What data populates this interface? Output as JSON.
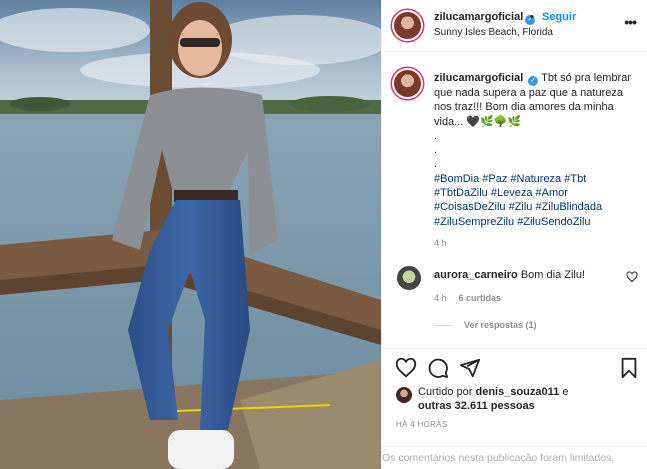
{
  "post": {
    "username": "zilucamargoficial",
    "verified_glyph": "✓",
    "dot": "•",
    "follow_label": "Seguir",
    "location": "Sunny Isles Beach, Florida",
    "more_icon": "more-icon"
  },
  "caption": {
    "username": "zilucamargoficial",
    "text": "Tbt só pra lembrar que nada supera a paz que a natureza nos traz!!! Bom dia amores da minha vida... 🖤🌿🌳🌿",
    "dots": [
      ".",
      ".",
      "."
    ],
    "hashtags": "#BomDia #Paz #Natureza #Tbt #TbtDaZilu #Leveza #Amor #CoisasDeZilu #Zilu #ZiluBlindada #ZiluSempreZilu #ZiluSendoZilu",
    "time": "4 h"
  },
  "comment": {
    "username": "aurora_carneiro",
    "text": "Bom dia Zilu!",
    "time": "4 h",
    "likes": "6 curtidas",
    "replies": "Ver respostas (1)"
  },
  "actions": {
    "icons": [
      "heart-icon",
      "comment-icon",
      "share-icon",
      "bookmark-icon"
    ]
  },
  "likes": {
    "prefix": "Curtido por",
    "user": "denis_souza011",
    "conj": "e",
    "others": "outras 32.611 pessoas"
  },
  "timestamp": "HÁ 4 HORAS",
  "comments_limited": "Os comentários nesta publicação foram limitados."
}
